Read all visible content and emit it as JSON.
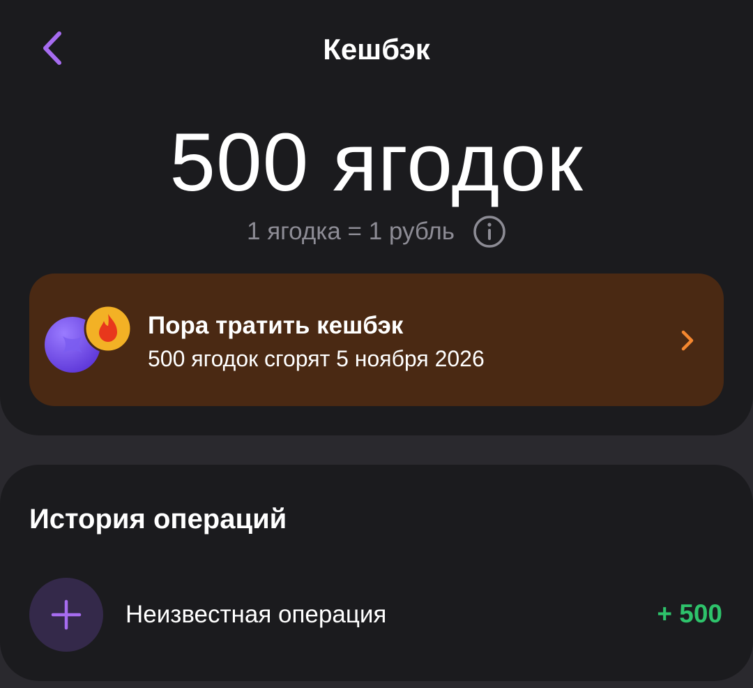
{
  "header": {
    "title": "Кешбэк"
  },
  "balance": {
    "value": "500 ягодок",
    "rate": "1 ягодка = 1 рубль"
  },
  "promo": {
    "title": "Пора тратить кешбэк",
    "subtitle": "500 ягодок сгорят 5 ноября 2026"
  },
  "history": {
    "title": "История операций",
    "operations": [
      {
        "name": "Неизвестная операция",
        "amount": "+ 500"
      }
    ]
  },
  "colors": {
    "accent": "#a66cf0",
    "promo_bg": "#4a2913",
    "promo_chevron": "#f5872f",
    "amount_positive": "#2ec36b"
  },
  "icons": {
    "back": "chevron-left-icon",
    "info": "info-icon",
    "berry": "berry-icon",
    "fire": "fire-icon",
    "promo_arrow": "chevron-right-icon",
    "operation": "plus-icon"
  }
}
